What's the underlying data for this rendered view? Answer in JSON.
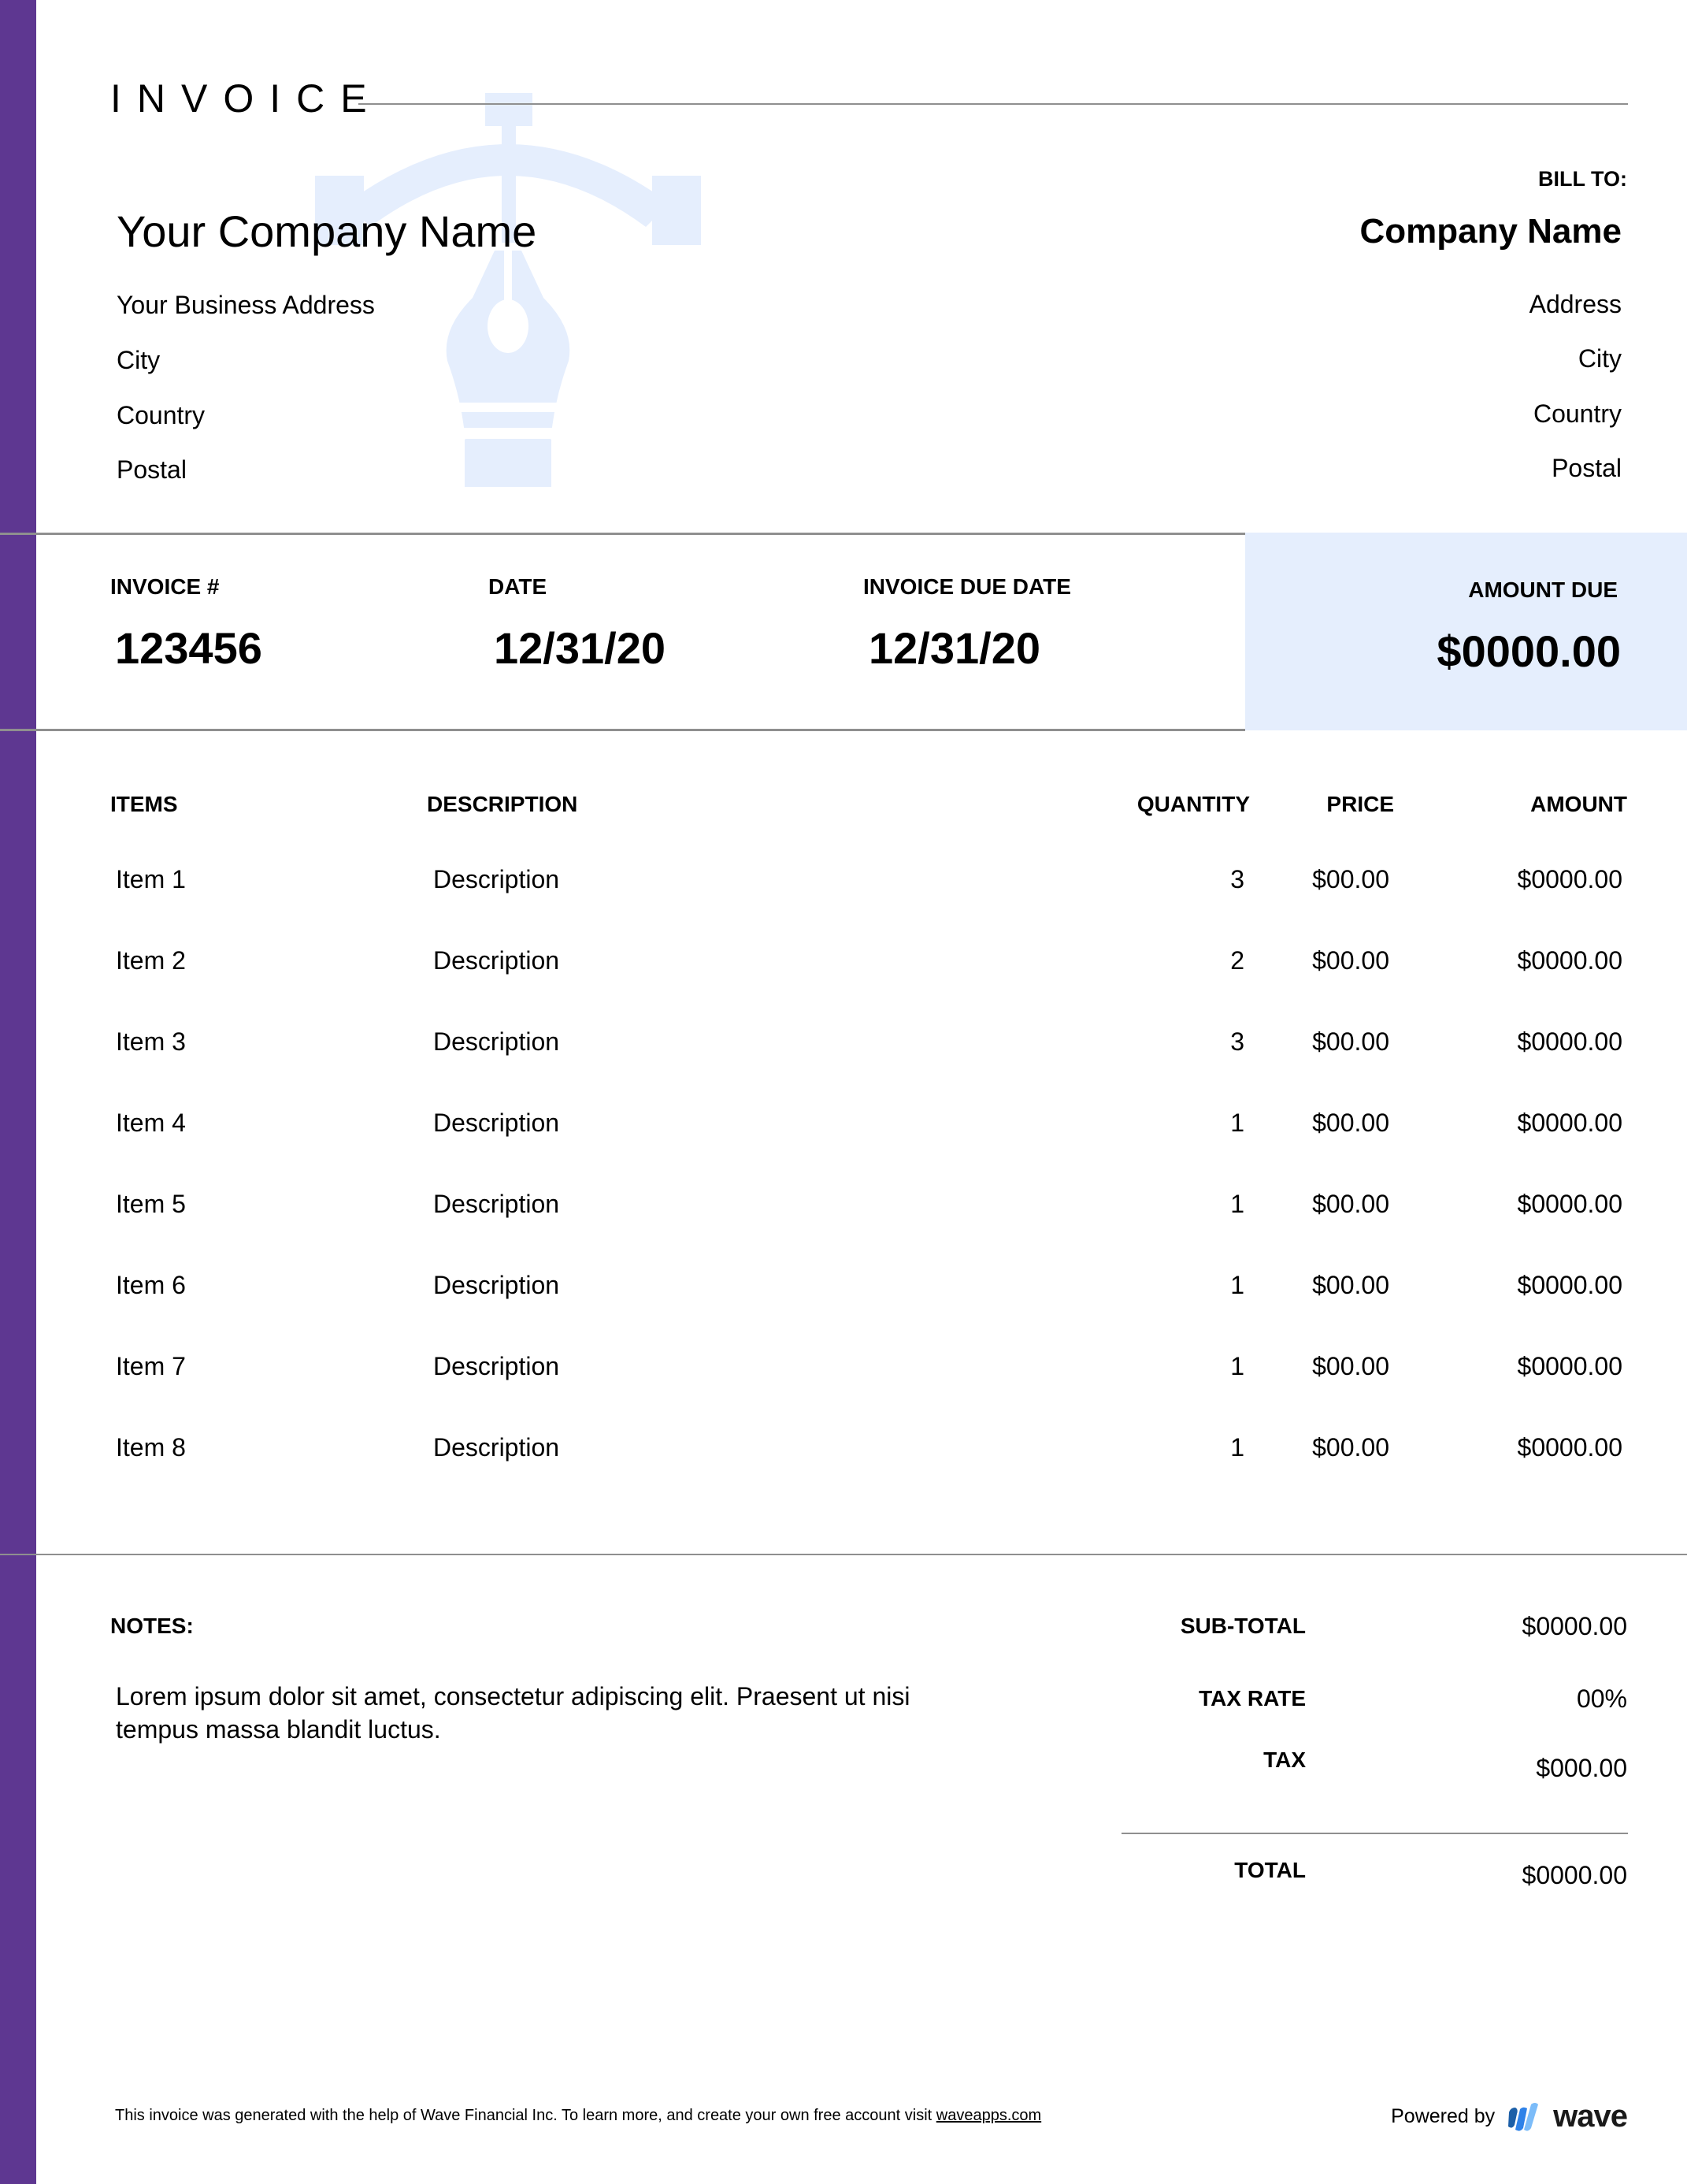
{
  "document": {
    "title": "INVOICE",
    "accent_color": "#5e3791",
    "highlight_color": "#e5eefd",
    "watermark_icon": "pen-nib-icon"
  },
  "from": {
    "company_name": "Your Company Name",
    "address_lines": [
      "Your Business Address",
      "City",
      "Country",
      "Postal"
    ]
  },
  "bill_to": {
    "label": "BILL TO:",
    "company_name": "Company Name",
    "address_lines": [
      "Address",
      "City",
      "Country",
      "Postal"
    ]
  },
  "meta": {
    "invoice_number_label": "INVOICE #",
    "invoice_number": "123456",
    "date_label": "DATE",
    "date": "12/31/20",
    "due_date_label": "INVOICE DUE DATE",
    "due_date": "12/31/20",
    "amount_due_label": "AMOUNT DUE",
    "amount_due": "$0000.00"
  },
  "table": {
    "columns": [
      "ITEMS",
      "DESCRIPTION",
      "QUANTITY",
      "PRICE",
      "AMOUNT"
    ],
    "rows": [
      {
        "item": "Item 1",
        "description": "Description",
        "quantity": "3",
        "price": "$00.00",
        "amount": "$0000.00"
      },
      {
        "item": "Item 2",
        "description": "Description",
        "quantity": "2",
        "price": "$00.00",
        "amount": "$0000.00"
      },
      {
        "item": "Item 3",
        "description": "Description",
        "quantity": "3",
        "price": "$00.00",
        "amount": "$0000.00"
      },
      {
        "item": "Item 4",
        "description": "Description",
        "quantity": "1",
        "price": "$00.00",
        "amount": "$0000.00"
      },
      {
        "item": "Item 5",
        "description": "Description",
        "quantity": "1",
        "price": "$00.00",
        "amount": "$0000.00"
      },
      {
        "item": "Item 6",
        "description": "Description",
        "quantity": "1",
        "price": "$00.00",
        "amount": "$0000.00"
      },
      {
        "item": "Item 7",
        "description": "Description",
        "quantity": "1",
        "price": "$00.00",
        "amount": "$0000.00"
      },
      {
        "item": "Item 8",
        "description": "Description",
        "quantity": "1",
        "price": "$00.00",
        "amount": "$0000.00"
      }
    ]
  },
  "notes": {
    "label": "NOTES:",
    "text": "Lorem ipsum dolor sit amet, consectetur adipiscing elit. Praesent ut nisi tempus massa blandit luctus."
  },
  "totals": {
    "subtotal_label": "SUB-TOTAL",
    "subtotal": "$0000.00",
    "tax_rate_label": "TAX RATE",
    "tax_rate": "00%",
    "tax_label": "TAX",
    "tax": "$000.00",
    "total_label": "TOTAL",
    "total": "$0000.00"
  },
  "footer": {
    "text": "This invoice was generated with the help of Wave Financial Inc. To learn more, and create your own free account visit ",
    "link_text": "waveapps.com",
    "powered_by": "Powered by",
    "brand": "wave",
    "brand_icon": "wave-logo-icon"
  }
}
